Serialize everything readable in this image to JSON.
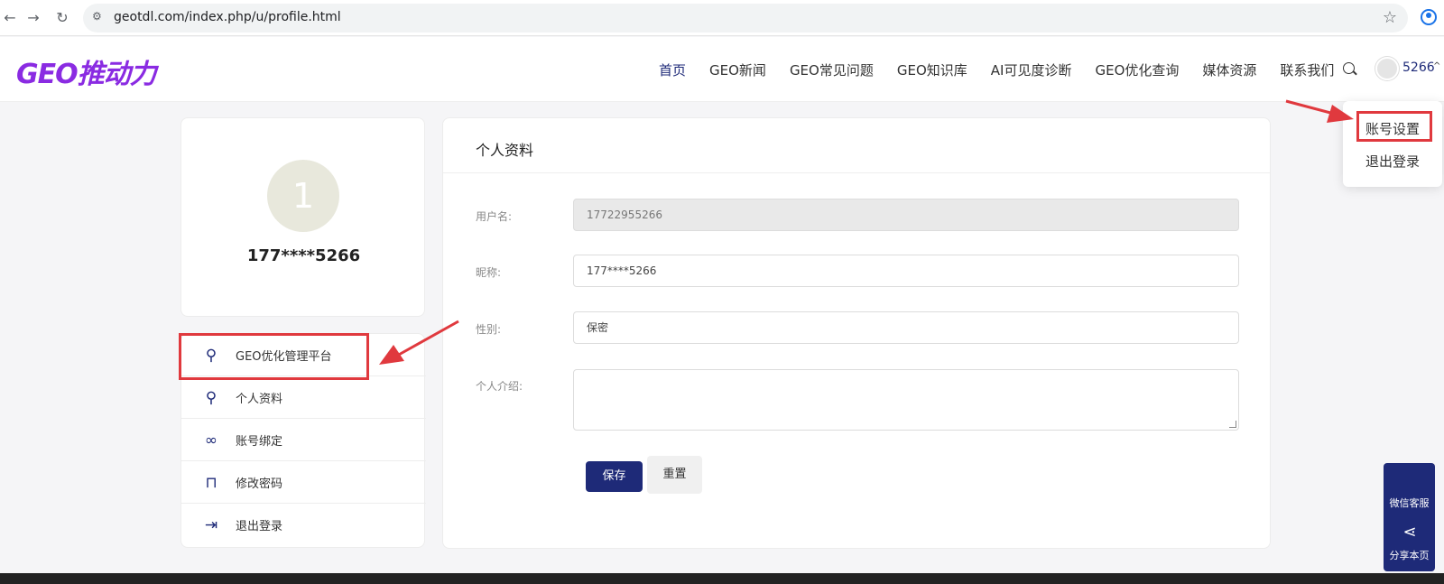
{
  "browser": {
    "url": "geotdl.com/index.php/u/profile.html",
    "back_glyph": "←",
    "forward_glyph": "→",
    "reload_glyph": "↻",
    "star_glyph": "☆",
    "tune_glyph": "⚙"
  },
  "header": {
    "logo": "GEO推动力",
    "nav": [
      "首页",
      "GEO新闻",
      "GEO常见问题",
      "GEO知识库",
      "AI可见度诊断",
      "GEO优化查询",
      "媒体资源",
      "联系我们"
    ],
    "user_name": "5266",
    "chevron_glyph": "^"
  },
  "dropdown": {
    "items": [
      "账号设置",
      "退出登录"
    ]
  },
  "user_card": {
    "avatar_initial": "1",
    "name": "177****5266"
  },
  "menu": {
    "items": [
      {
        "label": "GEO优化管理平台",
        "icon": "user-icon",
        "glyph": "⚲"
      },
      {
        "label": "个人资料",
        "icon": "user-icon",
        "glyph": "⚲"
      },
      {
        "label": "账号绑定",
        "icon": "link-icon",
        "glyph": "∞"
      },
      {
        "label": "修改密码",
        "icon": "lock-icon",
        "glyph": "⊓"
      },
      {
        "label": "退出登录",
        "icon": "logout-icon",
        "glyph": "⇥"
      }
    ]
  },
  "panel": {
    "title": "个人资料",
    "fields": {
      "username_label": "用户名:",
      "username_value": "17722955266",
      "nickname_label": "昵称:",
      "nickname_value": "177****5266",
      "gender_label": "性别:",
      "gender_value": "保密",
      "bio_label": "个人介绍:"
    },
    "save_label": "保存",
    "reset_label": "重置"
  },
  "side_widget": {
    "wechat_label": "微信客服",
    "share_label": "分享本页",
    "share_glyph": "⋖"
  },
  "colors": {
    "brand": "#1e2a78",
    "logo": "#8a2be2",
    "annotation": "#e0393e"
  }
}
